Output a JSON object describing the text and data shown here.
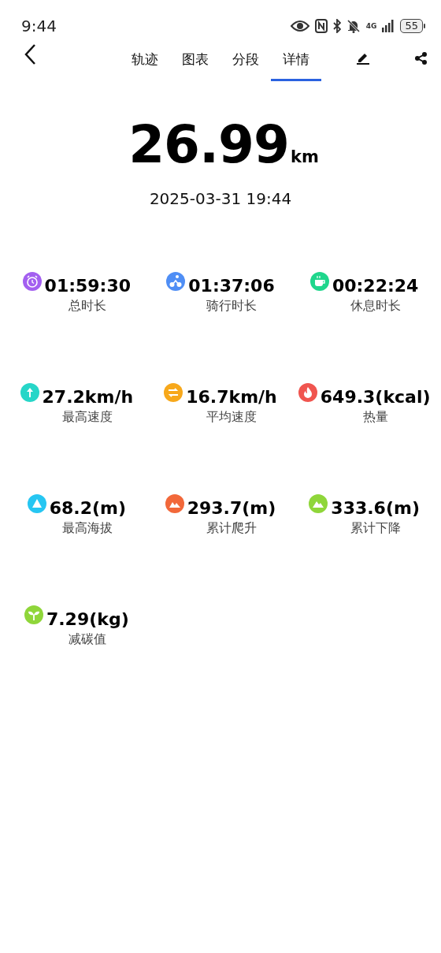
{
  "status_bar": {
    "time": "9:44",
    "network": "4G",
    "battery": "55"
  },
  "tabs": [
    {
      "label": "轨迹",
      "selected": false
    },
    {
      "label": "图表",
      "selected": false
    },
    {
      "label": "分段",
      "selected": false
    },
    {
      "label": "详情",
      "selected": true
    }
  ],
  "summary": {
    "distance": "26.99",
    "unit": "km",
    "date": "2025-03-31 19:44"
  },
  "stats": [
    {
      "kind": "clock",
      "color": "#a35ff0",
      "value": "01:59:30",
      "label": "总时长"
    },
    {
      "kind": "bike",
      "color": "#4f8ef5",
      "value": "01:37:06",
      "label": "骑行时长"
    },
    {
      "kind": "cup",
      "color": "#1fd68c",
      "value": "00:22:24",
      "label": "休息时长"
    },
    {
      "kind": "up",
      "color": "#27d6c8",
      "value": "27.2km/h",
      "label": "最高速度"
    },
    {
      "kind": "avg",
      "color": "#f7a81b",
      "value": "16.7km/h",
      "label": "平均速度"
    },
    {
      "kind": "flame",
      "color": "#f0554f",
      "value": "649.3(kcal)",
      "label": "热量"
    },
    {
      "kind": "peak",
      "color": "#26c6f2",
      "value": "68.2(m)",
      "label": "最高海拔"
    },
    {
      "kind": "climb",
      "color": "#f2683a",
      "value": "293.7(m)",
      "label": "累计爬升"
    },
    {
      "kind": "descent",
      "color": "#8fd63a",
      "value": "333.6(m)",
      "label": "累计下降"
    },
    {
      "kind": "sprout",
      "color": "#8fd63a",
      "value": "7.29(kg)",
      "label": "减碳值"
    }
  ]
}
